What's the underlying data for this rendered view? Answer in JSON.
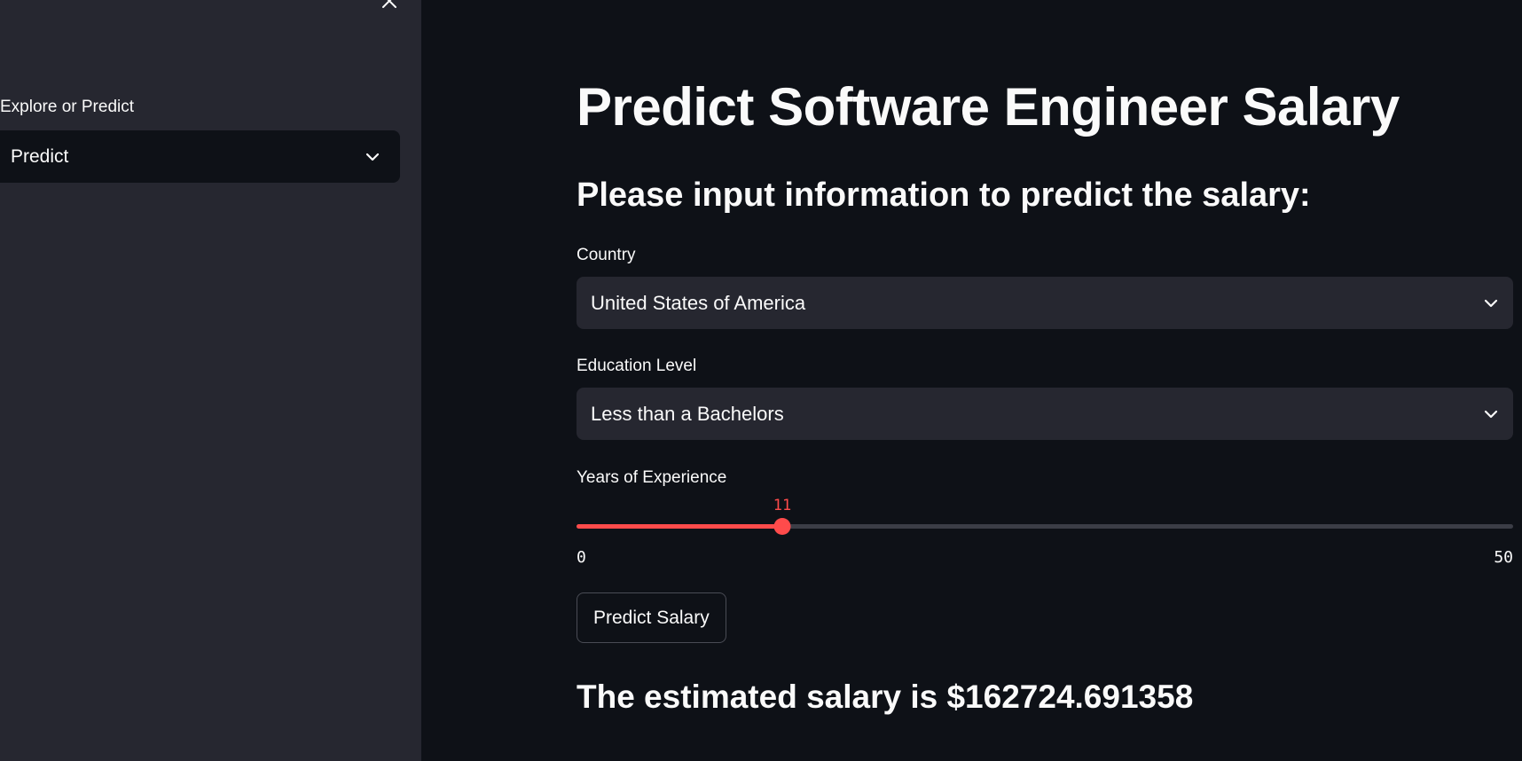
{
  "sidebar": {
    "label": "Explore or Predict",
    "select_value": "Predict"
  },
  "main": {
    "title": "Predict Software Engineer Salary",
    "subtitle": "Please input information to predict the salary:",
    "country": {
      "label": "Country",
      "value": "United States of America"
    },
    "education": {
      "label": "Education Level",
      "value": "Less than a Bachelors"
    },
    "experience": {
      "label": "Years of Experience",
      "value": "11",
      "min": "0",
      "max": "50",
      "fraction": 0.22
    },
    "button_label": "Predict Salary",
    "result": "The estimated salary is $162724.691358"
  },
  "colors": {
    "accent": "#ff4b4b",
    "background": "#0e1117",
    "sidebar": "#262730"
  },
  "icons": {
    "close": "close-icon",
    "chevron": "chevron-down-icon"
  }
}
